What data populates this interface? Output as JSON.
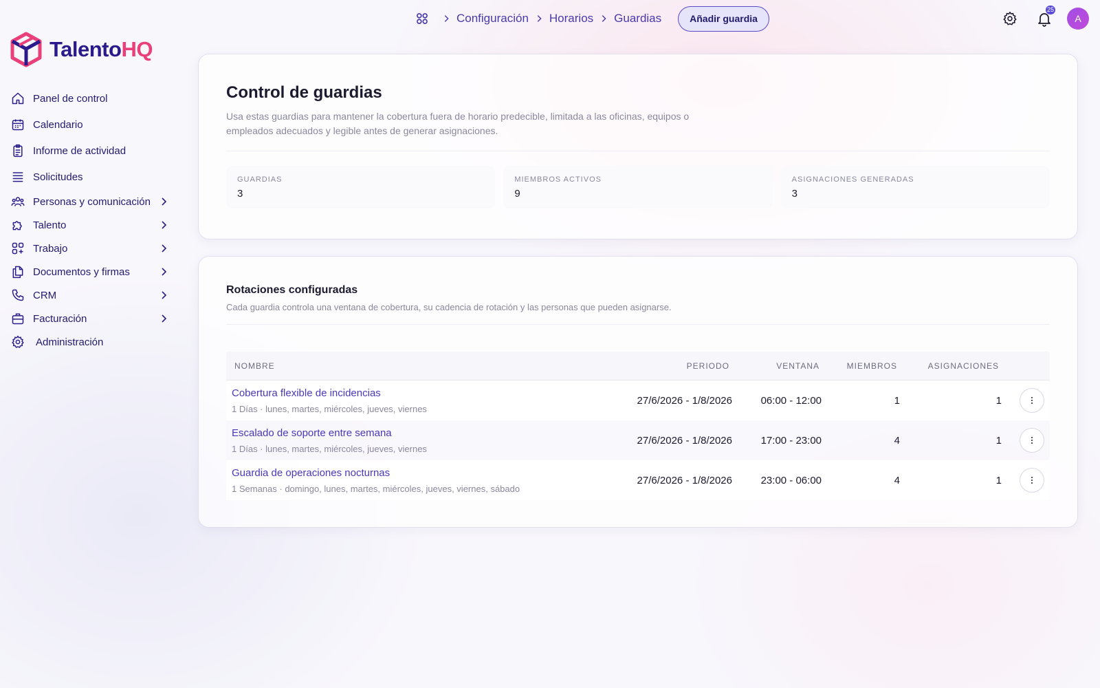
{
  "brand": {
    "name_part1": "Talento",
    "name_part2": "HQ"
  },
  "sidebar": {
    "items": [
      {
        "label": "Panel de control",
        "icon": "home-icon",
        "has_children": false
      },
      {
        "label": "Calendario",
        "icon": "calendar-icon",
        "has_children": false
      },
      {
        "label": "Informe de actividad",
        "icon": "clipboard-icon",
        "has_children": false
      },
      {
        "label": "Solicitudes",
        "icon": "list-icon",
        "has_children": false
      },
      {
        "label": "Personas y comunicación",
        "icon": "users-icon",
        "has_children": true
      },
      {
        "label": "Talento",
        "icon": "puzzle-icon",
        "has_children": true
      },
      {
        "label": "Trabajo",
        "icon": "grid-plus-icon",
        "has_children": true
      },
      {
        "label": "Documentos y firmas",
        "icon": "documents-icon",
        "has_children": true
      },
      {
        "label": "CRM",
        "icon": "phone-icon",
        "has_children": true
      },
      {
        "label": "Facturación",
        "icon": "briefcase-icon",
        "has_children": true
      },
      {
        "label": "Administración",
        "icon": "gear-icon",
        "has_children": false
      }
    ]
  },
  "header": {
    "breadcrumb": [
      "Configuración",
      "Horarios",
      "Guardias"
    ],
    "add_button": "Añadir guardia",
    "notification_count": "25",
    "avatar_initial": "A"
  },
  "overview": {
    "title": "Control de guardias",
    "description": "Usa estas guardias para mantener la cobertura fuera de horario predecible, limitada a las oficinas, equipos o empleados adecuados y legible antes de generar asignaciones.",
    "stats": [
      {
        "label": "GUARDIAS",
        "value": "3"
      },
      {
        "label": "MIEMBROS ACTIVOS",
        "value": "9"
      },
      {
        "label": "ASIGNACIONES GENERADAS",
        "value": "3"
      }
    ]
  },
  "rotations": {
    "title": "Rotaciones configuradas",
    "description": "Cada guardia controla una ventana de cobertura, su cadencia de rotación y las personas que pueden asignarse.",
    "columns": [
      "NOMBRE",
      "PERIODO",
      "VENTANA",
      "MIEMBROS",
      "ASIGNACIONES"
    ],
    "rows": [
      {
        "name": "Cobertura flexible de incidencias",
        "detail": "1 Días · lunes, martes, miércoles, jueves, viernes",
        "period": "27/6/2026 - 1/8/2026",
        "window": "06:00 - 12:00",
        "members": "1",
        "assignments": "1"
      },
      {
        "name": "Escalado de soporte entre semana",
        "detail": "1 Días · lunes, martes, miércoles, jueves, viernes",
        "period": "27/6/2026 - 1/8/2026",
        "window": "17:00 - 23:00",
        "members": "4",
        "assignments": "1"
      },
      {
        "name": "Guardia de operaciones nocturnas",
        "detail": "1 Semanas · domingo, lunes, martes, miércoles, jueves, viernes, sábado",
        "period": "27/6/2026 - 1/8/2026",
        "window": "23:00 - 06:00",
        "members": "4",
        "assignments": "1"
      }
    ]
  },
  "colors": {
    "accent": "#4a38b8",
    "brand_dark": "#2a1a8c",
    "brand_pink": "#e9407a"
  }
}
